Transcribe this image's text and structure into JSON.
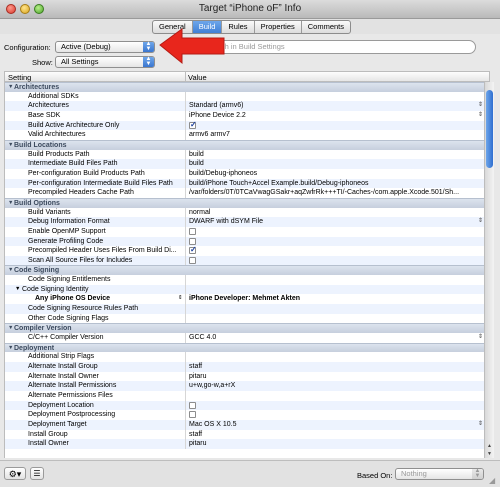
{
  "window": {
    "title": "Target “iPhone oF” Info"
  },
  "tabs": [
    "General",
    "Build",
    "Rules",
    "Properties",
    "Comments"
  ],
  "active_tab": "Build",
  "configuration": {
    "label": "Configuration:",
    "value": "Active (Debug)"
  },
  "show": {
    "label": "Show:",
    "value": "All Settings"
  },
  "search": {
    "placeholder": "Search in Build Settings"
  },
  "table": {
    "col_setting": "Setting",
    "col_value": "Value"
  },
  "rows": [
    {
      "type": "group",
      "label": "Architectures"
    },
    {
      "label": "Additional SDKs",
      "value": ""
    },
    {
      "label": "Architectures",
      "value": "Standard (armv6)",
      "popup": true
    },
    {
      "label": "Base SDK",
      "value": "iPhone Device 2.2",
      "popup": true
    },
    {
      "label": "Build Active Architecture Only",
      "check": true
    },
    {
      "label": "Valid Architectures",
      "value": "armv6 armv7"
    },
    {
      "type": "group",
      "label": "Build Locations"
    },
    {
      "label": "Build Products Path",
      "value": "build"
    },
    {
      "label": "Intermediate Build Files Path",
      "value": "build"
    },
    {
      "label": "Per-configuration Build Products Path",
      "value": "build/Debug-iphoneos"
    },
    {
      "label": "Per-configuration Intermediate Build Files Path",
      "value": "build/iPhone Touch+Accel Example.build/Debug-iphoneos"
    },
    {
      "label": "Precompiled Headers Cache Path",
      "value": "/var/folders/0T/0TCaVwagGSakr+aqZwfrRk+++TI/-Caches-/com.apple.Xcode.501/Sh..."
    },
    {
      "type": "group",
      "label": "Build Options"
    },
    {
      "label": "Build Variants",
      "value": "normal"
    },
    {
      "label": "Debug Information Format",
      "value": "DWARF with dSYM File",
      "popup": true
    },
    {
      "label": "Enable OpenMP Support",
      "check": false
    },
    {
      "label": "Generate Profiling Code",
      "check": false
    },
    {
      "label": "Precompiled Header Uses Files From Build Di...",
      "check": true
    },
    {
      "label": "Scan All Source Files for Includes",
      "check": false
    },
    {
      "type": "group",
      "label": "Code Signing"
    },
    {
      "label": "Code Signing Entitlements",
      "value": ""
    },
    {
      "label": "Code Signing Identity",
      "value": "",
      "tri": "down",
      "indent": "mid"
    },
    {
      "label": "Any iPhone OS Device",
      "value": "iPhone Developer: Mehmet Akten",
      "bold": true,
      "indent": "deep",
      "marker": true
    },
    {
      "label": "Code Signing Resource Rules Path",
      "value": ""
    },
    {
      "label": "Other Code Signing Flags",
      "value": ""
    },
    {
      "type": "group",
      "label": "Compiler Version"
    },
    {
      "label": "C/C++ Compiler Version",
      "value": "GCC 4.0",
      "popup": true
    },
    {
      "type": "group",
      "label": "Deployment"
    },
    {
      "label": "Additional Strip Flags",
      "value": ""
    },
    {
      "label": "Alternate Install Group",
      "value": "staff"
    },
    {
      "label": "Alternate Install Owner",
      "value": "pitaru"
    },
    {
      "label": "Alternate Install Permissions",
      "value": "u+w,go-w,a+rX"
    },
    {
      "label": "Alternate Permissions Files",
      "value": ""
    },
    {
      "label": "Deployment Location",
      "check": false
    },
    {
      "label": "Deployment Postprocessing",
      "check": false
    },
    {
      "label": "Deployment Target",
      "value": "Mac OS X 10.5",
      "popup": true
    },
    {
      "label": "Install Group",
      "value": "staff"
    },
    {
      "label": "Install Owner",
      "value": "pitaru"
    }
  ],
  "bottom": {
    "based_on_label": "Based On:",
    "based_on_value": "Nothing"
  },
  "icons": {
    "gear": "gear-icon",
    "list": "list-icon",
    "search": "search-icon",
    "arrow": "red-arrow-annotation"
  },
  "colors": {
    "accent": "#3f7fd6",
    "arrow": "#e8261c"
  }
}
